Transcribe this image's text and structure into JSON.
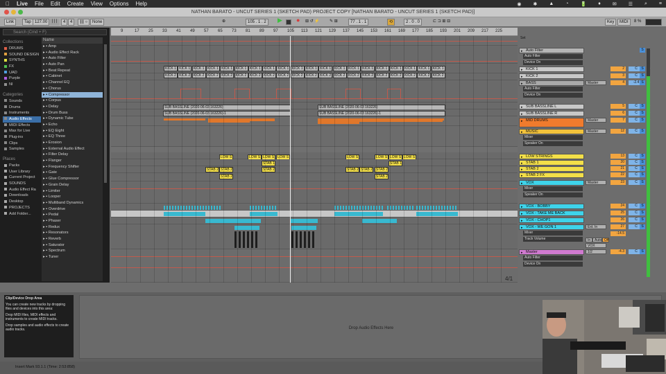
{
  "menubar": {
    "apple": "",
    "app": "Live",
    "items": [
      "File",
      "Edit",
      "Create",
      "View",
      "Options",
      "Help"
    ],
    "status": [
      "◉",
      "✱",
      "▲",
      "◔",
      "🔋",
      "♦",
      "✉",
      "☰",
      "⌕",
      "≡"
    ]
  },
  "window": {
    "title": "NATHAN BARATO - UNCUT SERIES 1 (SKETCH PAD) PROJECT COPY  [NATHAN BARATO - UNCUT SERIES 1 (SKETCH PAD)]"
  },
  "transport": {
    "link": "Link",
    "tap": "Tap",
    "tempo": "127.00",
    "meter_num": "4",
    "meter_den": "4",
    "dots": "∥∥ ○",
    "none": "None",
    "position": "105 .   1 .   2",
    "loop_start": "77 .   1 .   1",
    "loop_len": "2 .   0 .   0",
    "key": "Key",
    "midi": "MIDI",
    "cpu": "8 %",
    "colors": {
      "play": "#3fbf3f",
      "record": "#d63d3d"
    }
  },
  "browser": {
    "search_placeholder": "Search (Cmd + F)",
    "collections_header": "Collections",
    "collections": [
      {
        "label": "DRUMS",
        "color": "#e06048"
      },
      {
        "label": "SOUND DESIGN",
        "color": "#e0a040"
      },
      {
        "label": "SYNTHS",
        "color": "#e0e040"
      },
      {
        "label": "FX",
        "color": "#50c050"
      },
      {
        "label": "UAD",
        "color": "#50a0e0"
      },
      {
        "label": "Purple",
        "color": "#b060e0"
      },
      {
        "label": "NI",
        "color": "#909090"
      }
    ],
    "categories_header": "Categories",
    "categories": [
      "Sounds",
      "Drums",
      "Instruments",
      "Audio Effects",
      "MIDI Effects",
      "Max for Live",
      "Plug-ins",
      "Clips",
      "Samples"
    ],
    "places_header": "Places",
    "places": [
      "Packs",
      "User Library",
      "Current Project",
      "SOUNDS",
      "Audio Effect Ra",
      "Downloads",
      "Desktop",
      "PROJECTS",
      "Add Folder..."
    ],
    "name_header": "Name",
    "names": [
      "Amp",
      "Audio Effect Rack",
      "Auto Filter",
      "Auto Pan",
      "Beat Repeat",
      "Cabinet",
      "Channel EQ",
      "Chorus",
      "Compressor",
      "Corpus",
      "Delay",
      "Drum Buss",
      "Dynamic Tube",
      "Echo",
      "EQ Eight",
      "EQ Three",
      "Erosion",
      "External Audio Effect",
      "Filter Delay",
      "Flanger",
      "Frequency Shifter",
      "Gate",
      "Glue Compressor",
      "Grain Delay",
      "Limiter",
      "Looper",
      "Multiband Dynamics",
      "Overdrive",
      "Pedal",
      "Phaser",
      "Redux",
      "Resonators",
      "Reverb",
      "Saturator",
      "Spectrum",
      "Tuner"
    ]
  },
  "ruler": {
    "bars": [
      "9",
      "17",
      "25",
      "33",
      "41",
      "49",
      "57",
      "65",
      "73",
      "81",
      "89",
      "97",
      "105",
      "113",
      "121",
      "129",
      "137",
      "145",
      "153",
      "161",
      "169",
      "177",
      "185",
      "193",
      "201",
      "209",
      "217",
      "225"
    ],
    "times": [
      "0:30",
      "1:00",
      "1:30",
      "2:00",
      "2:30",
      "3:00",
      "3:30",
      "4:00",
      "4:30",
      "5:00",
      "5:30",
      "6:00",
      "6:30",
      "7:00"
    ],
    "marker": "S"
  },
  "arrangement": {
    "kick1_clips": [
      "KICK 1",
      "KICK 1",
      "KICK 1",
      "KICK 1",
      "KICK 1",
      "KICK 1",
      "KICK 1",
      "KICK 1",
      "KICK 1",
      "KICK 1",
      "KICK 1",
      "KICK 1",
      "KICK 1",
      "KICK 1",
      "KICK 1",
      "KICK 1",
      "KICK 1",
      "KICK 1",
      "KICK 1",
      "KICK 1"
    ],
    "kick2_clips": [
      "KICK 2",
      "KICK 2",
      "KICK 2",
      "KICK 2",
      "KICK 2",
      "KICK 2",
      "KICK 2",
      "KICK 2",
      "KICK 2",
      "KICK 2",
      "KICK 2",
      "KICK 2",
      "KICK 2",
      "KICK 2",
      "KICK 2",
      "KICK 2",
      "KICK 2",
      "KICK 2",
      "KICK 2",
      "KICK 2"
    ],
    "sub_l": [
      "SUB BASSLINE (2020-06-03 163226)",
      "SUB BASSLINE (2020-06-03 163226)"
    ],
    "sub_r": [
      "SUB BASSLINE (2020-06-03 163226)-1",
      "SUB BASSLINE (2020-06-03 163226)-1"
    ],
    "low_strings": [
      "LOW ST",
      "LOW ST",
      "LOW ST",
      "LOW ST",
      "LOW ST",
      "LOW ST",
      "LOW ST",
      "LOW ST"
    ],
    "stab1": [
      "STAB 1",
      "STAB 1"
    ],
    "stab2": [
      "STAB 2",
      "STAB 2",
      "STAB 2",
      "STAB 2",
      "STAB 2",
      "STAB 2"
    ],
    "stab2fx": [
      "STAB 2",
      "STAB 2"
    ],
    "page": "4/1"
  },
  "mixer": {
    "tracks": [
      {
        "id": "autofilter_top",
        "label": "Auto Filter",
        "color": "#b5b5b5"
      },
      {
        "id": "kick1",
        "label": "KICK 1",
        "color": "#c8c8c8",
        "num": "2",
        "pan": "C"
      },
      {
        "id": "kick2",
        "label": "KICK 2",
        "color": "#c8c8c8",
        "num": "3",
        "pan": "C"
      },
      {
        "id": "bass",
        "label": "BASS",
        "color": "#a9a9a9",
        "num": "4",
        "pan": "-2.4",
        "route": "Master"
      },
      {
        "id": "subl",
        "label": "SUB BASSLINE L",
        "color": "#c8c8c8",
        "num": "5",
        "pan": "C"
      },
      {
        "id": "subr",
        "label": "SUB BASSLINE R",
        "color": "#c8c8c8",
        "num": "6",
        "pan": "C"
      },
      {
        "id": "mid",
        "label": "MID DRUMS",
        "color": "#f07b2d",
        "num": "7",
        "pan": "C",
        "route": "Master"
      },
      {
        "id": "music",
        "label": "MUSIC",
        "color": "#f2c23b",
        "num": "12",
        "pan": "C",
        "route": "Master"
      },
      {
        "id": "lows",
        "label": "LOW STRINGS",
        "color": "#f3df49",
        "num": "13",
        "pan": "C"
      },
      {
        "id": "stab1",
        "label": "STAB 1",
        "color": "#f3df49",
        "num": "20",
        "pan": "C"
      },
      {
        "id": "stab2",
        "label": "STAB 2",
        "color": "#f3df49",
        "num": "21",
        "pan": "C"
      },
      {
        "id": "stab2fx",
        "label": "STAB 2 FX",
        "color": "#f3df49",
        "num": "22",
        "pan": "C"
      },
      {
        "id": "vox",
        "label": "VOX",
        "color": "#3ed3ea",
        "num": "23",
        "pan": "C",
        "route": "Master"
      },
      {
        "id": "bobby",
        "label": "VOX - BOBBY",
        "color": "#3ed3ea",
        "num": "24",
        "pan": "C"
      },
      {
        "id": "take",
        "label": "VOX - TAKE ME BACK",
        "color": "#3ed3ea",
        "num": "25",
        "pan": "C"
      },
      {
        "id": "chop",
        "label": "VOX - CHOP1",
        "color": "#3ed3ea",
        "num": "26",
        "pan": "C"
      },
      {
        "id": "wegon",
        "label": "VOX - WE GON 1",
        "color": "#3ed3ea",
        "num": "27",
        "pan": "C",
        "route": "Ext. In"
      },
      {
        "id": "master",
        "label": "Master",
        "color": "#d07ad0",
        "num": "-4.3",
        "pan": "C",
        "route": "1/2"
      }
    ],
    "devices": {
      "auto_filter": "Auto Filter",
      "device_on": "Device On",
      "mixer": "Mixer",
      "speaker_on": "Speaker On",
      "track_volume": "Track Volume",
      "in": "In",
      "auto": "Auto",
      "off": "Off",
      "vox": "VOX",
      "vol": "-14.5"
    },
    "set_label": "Set"
  },
  "bottom": {
    "clip_title": "Clip/Device Drop Area",
    "clip_text": "You can create new tracks by dropping files and devices into this area:",
    "bullets": [
      "Drop MIDI files, MIDI effects and instruments to create MIDI tracks.",
      "Drop samples and audio effects to create audio tracks."
    ],
    "drop_label": "Drop Audio Effects Here",
    "status": "Insert Mark 93.1.1 (Time: 2:53:858)"
  }
}
